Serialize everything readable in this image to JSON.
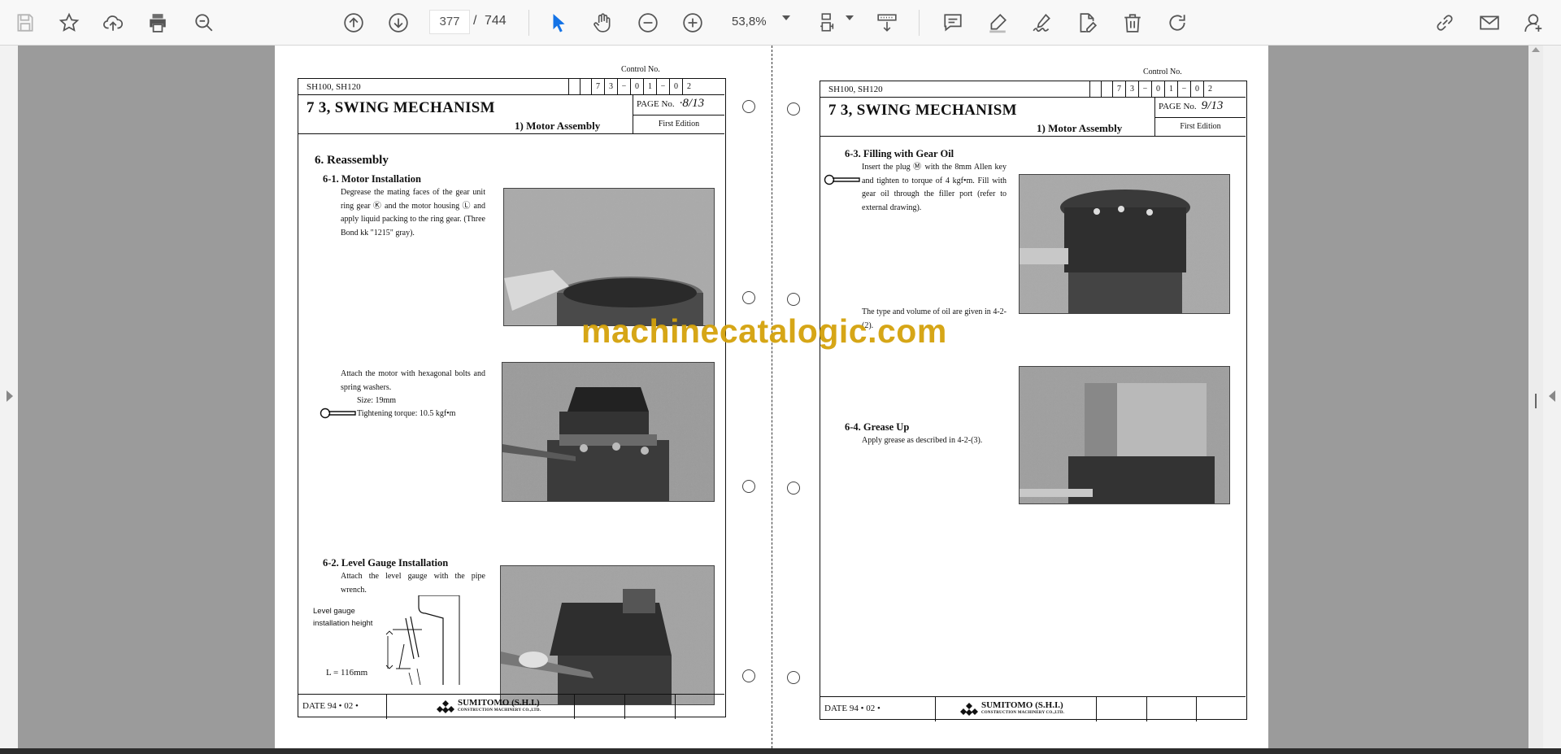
{
  "toolbar": {
    "current_page": "377",
    "page_separator": "/",
    "total_pages": "744",
    "zoom": "53,8%"
  },
  "colors": {
    "accent": "#1473e6",
    "viewer_bg": "#9b9b9b",
    "watermark": "#d4a20b"
  },
  "icons": [
    "save-icon",
    "star-icon",
    "cloud-upload-icon",
    "print-icon",
    "zoom-search-icon",
    "page-up-icon",
    "page-down-icon",
    "select-cursor-icon",
    "hand-icon",
    "zoom-out-icon",
    "zoom-in-icon",
    "page-fit-icon",
    "scroll-mode-icon",
    "comment-icon",
    "highlight-icon",
    "sign-icon",
    "edit-pdf-icon",
    "delete-icon",
    "rotate-icon",
    "share-link-icon",
    "mail-icon",
    "add-user-icon"
  ],
  "watermark": "machinecatalogic.com",
  "left_page": {
    "control_label": "Control No.",
    "model": "SH100,   SH120",
    "control_code": [
      "7",
      "3",
      "−",
      "0",
      "1",
      "−",
      "0",
      "2"
    ],
    "section_title": "7 3,    SWING MECHANISM",
    "sub_title": "1)   Motor Assembly",
    "page_label": "PAGE  No.",
    "page_value": "·8/13",
    "edition": "First Edition",
    "heading": "6. Reassembly",
    "sub1": "6-1. Motor Installation",
    "text1": "Degrease the mating faces of the gear unit ring gear Ⓚ and the motor housing Ⓛ and apply liquid packing to the ring gear. (Three Bond kk \"1215\" gray).",
    "text2": "Attach the motor with hexagonal bolts and spring washers.",
    "text2b": "Size: 19mm",
    "text2c": "Tightening torque: 10.5 kgf•m",
    "sub2": "6-2. Level Gauge Installation",
    "text3": "Attach the level gauge with the pipe wrench.",
    "gauge_label1": "Level gauge",
    "gauge_label2": "installation height",
    "gauge_label3": "L = 116mm",
    "footer_date": "DATE    94  •  02  •",
    "footer_logo": "SUMITOMO (S.H.I.)",
    "footer_logo_sub": "CONSTRUCTION MACHINERY CO.,LTD."
  },
  "right_page": {
    "control_label": "Control No.",
    "model": "SH100,   SH120",
    "control_code": [
      "7",
      "3",
      "−",
      "0",
      "1",
      "−",
      "0",
      "2"
    ],
    "section_title": "7 3,    SWING MECHANISM",
    "sub_title": "1)   Motor Assembly",
    "page_label": "PAGE  No.",
    "page_value": "9/13",
    "edition": "First Edition",
    "sub1": "6-3. Filling with Gear Oil",
    "text1": "Insert the plug Ⓜ with the 8mm Allen key and tighten to torque of 4 kgf•m. Fill with gear oil through the filler port (refer to external drawing).",
    "text2": "The type and volume of oil are given in 4-2-(2).",
    "sub2": "6-4. Grease Up",
    "text3": "Apply grease as described in 4-2-(3).",
    "footer_date": "DATE    94  •  02  •",
    "footer_logo": "SUMITOMO (S.H.I.)",
    "footer_logo_sub": "CONSTRUCTION MACHINERY CO.,LTD."
  }
}
